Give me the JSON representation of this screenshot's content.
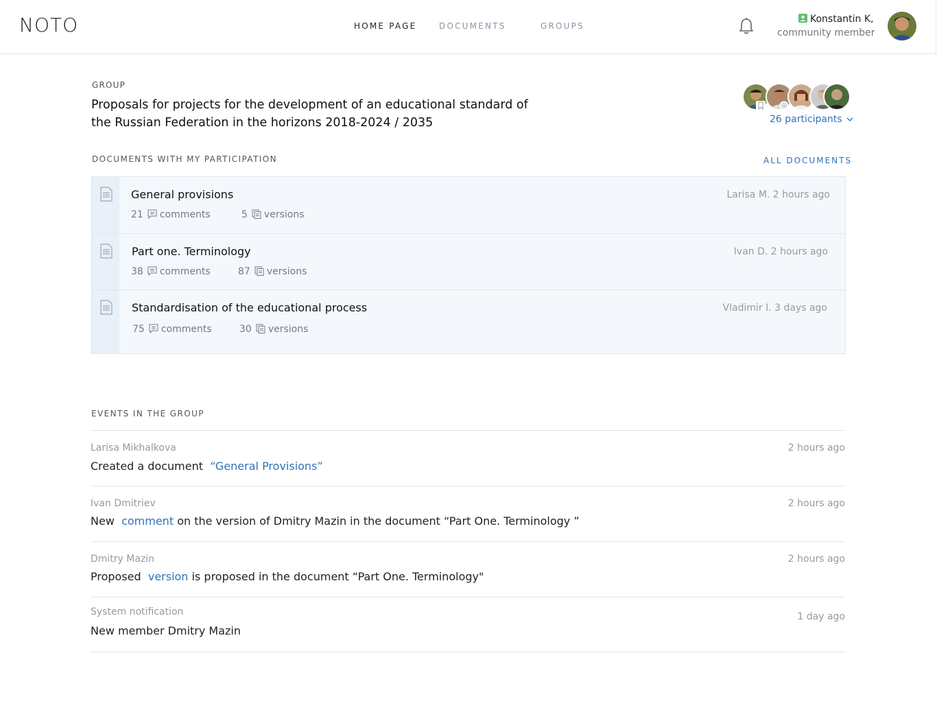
{
  "header": {
    "logo": "NOTO",
    "nav": [
      {
        "label": "HOME PAGE"
      },
      {
        "label": "DOCUMENTS"
      },
      {
        "label": "GROUPS"
      }
    ],
    "user": {
      "name": "Konstantin K,",
      "role": "community member"
    }
  },
  "group": {
    "kicker": "GROUP",
    "title": "Proposals for projects for the development of an educational standard of the Russian Federation in the horizons 2018-2024 / 2035",
    "participants_label": "26 participants"
  },
  "documents": {
    "section_label": "DOCUMENTS WITH MY PARTICIPATION",
    "all_label": "ALL DOCUMENTS",
    "items": [
      {
        "title": "General provisions",
        "comments_count": "21",
        "comments_label": "comments",
        "versions_count": "5",
        "versions_label": "versions",
        "author_time": "Larisa M. 2 hours ago"
      },
      {
        "title": "Part one. Terminology",
        "comments_count": "38",
        "comments_label": "comments",
        "versions_count": "87",
        "versions_label": "versions",
        "author_time": "Ivan D. 2 hours ago"
      },
      {
        "title": "Standardisation of the educational process",
        "comments_count": "75",
        "comments_label": "comments",
        "versions_count": "30",
        "versions_label": "versions",
        "author_time": "Vladimir I. 3 days ago"
      }
    ]
  },
  "events": {
    "section_label": "EVENTS IN THE GROUP",
    "items": [
      {
        "author": "Larisa Mikhalkova",
        "time": "2 hours ago",
        "pre": "Created a document",
        "link": "“General Provisions”",
        "post": ""
      },
      {
        "author": "Ivan Dmitriev",
        "time": "2 hours ago",
        "pre": "New",
        "link": "comment",
        "post": "on the version of Dmitry Mazin in the document “Part One. Terminology ”"
      },
      {
        "author": "Dmitry Mazin",
        "time": "2 hours ago",
        "pre": "Proposed",
        "link": "version",
        "post": "is proposed in the document “Part One. Terminology\""
      },
      {
        "author": "System notification",
        "time": "1 day ago",
        "pre": "New member Dmitry Mazin",
        "link": "",
        "post": ""
      }
    ]
  },
  "colors": {
    "accent": "#2f73b8",
    "badge": "#5bbf72",
    "doc_bg": "#f4f8fc"
  }
}
